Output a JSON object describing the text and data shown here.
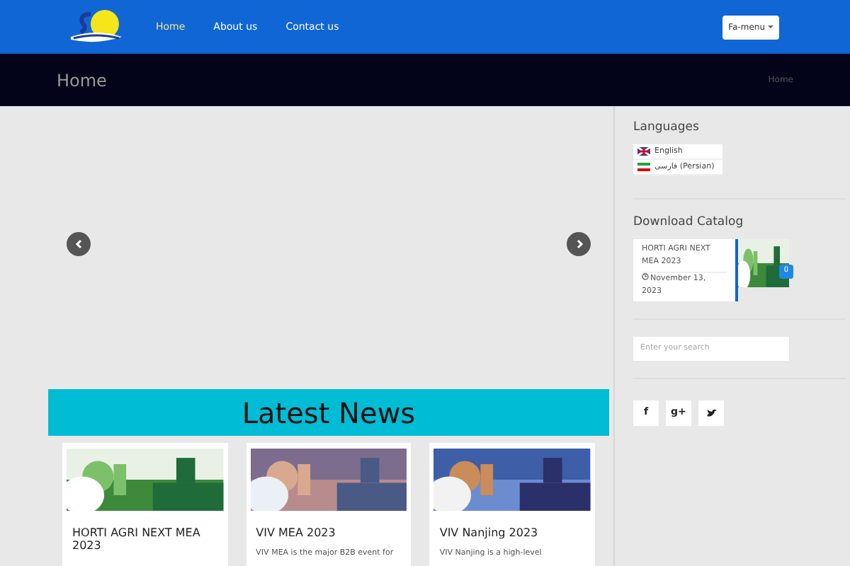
{
  "nav": {
    "items": [
      {
        "label": "Home",
        "selected": true
      },
      {
        "label": "About us",
        "selected": false
      },
      {
        "label": "Contact us",
        "selected": false
      }
    ],
    "menu_button": "Fa-menu"
  },
  "page_title": "Home",
  "breadcrumb": "Home",
  "news": {
    "title": "Latest News",
    "cards": [
      {
        "title": "HORTI AGRI NEXT MEA 2023"
      },
      {
        "title": "VIV MEA 2023",
        "text": "VIV MEA is the major B2B event for"
      },
      {
        "title": "VIV Nanjing 2023",
        "text": "VIV Nanjing is a high-level"
      }
    ]
  },
  "sidebar": {
    "languages_title": "Languages",
    "languages": [
      {
        "label": "English"
      },
      {
        "label": "فارسی (Persian)"
      }
    ],
    "catalog_title": "Download Catalog",
    "catalog": {
      "title": "HORTI AGRI NEXT MEA 2023",
      "date": "November 13, 2023",
      "badge": "0"
    },
    "search": {
      "placeholder": "Enter your search"
    },
    "social": [
      {
        "kind": "facebook",
        "label": "f"
      },
      {
        "kind": "google",
        "label": "g+"
      },
      {
        "kind": "twitter"
      }
    ]
  }
}
